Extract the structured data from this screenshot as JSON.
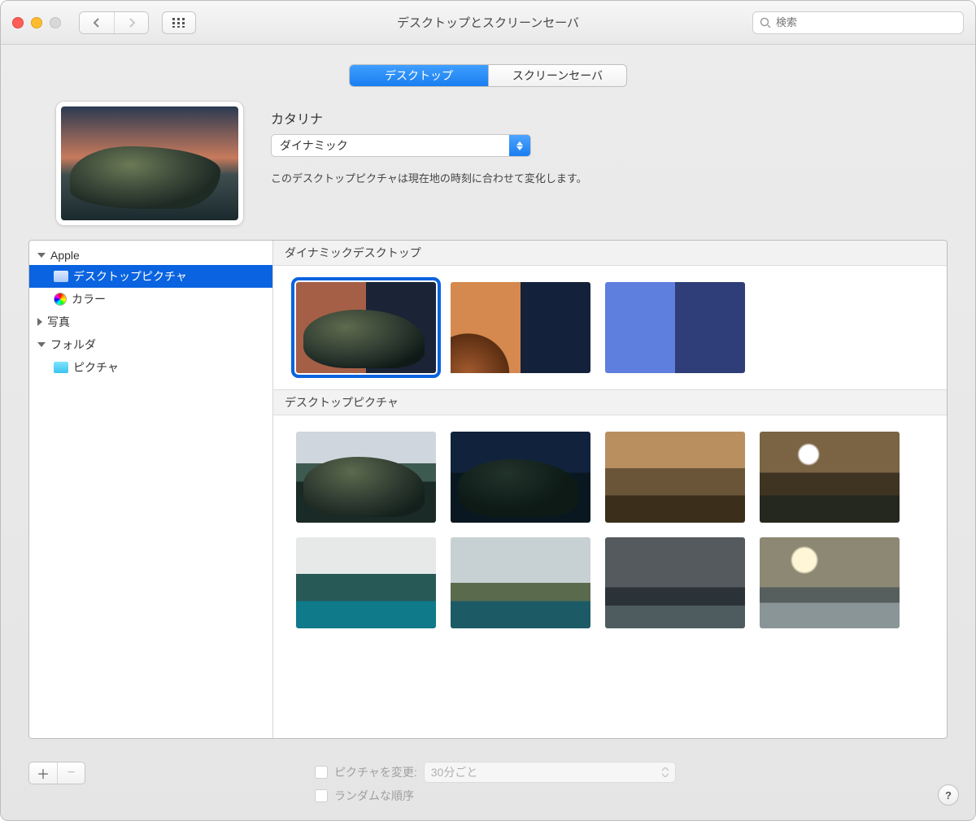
{
  "window": {
    "title": "デスクトップとスクリーンセーバ"
  },
  "search": {
    "placeholder": "検索"
  },
  "tabs": {
    "desktop": "デスクトップ",
    "screensaver": "スクリーンセーバ"
  },
  "selection": {
    "name": "カタリナ",
    "mode": "ダイナミック",
    "description": "このデスクトップピクチャは現在地の時刻に合わせて変化します。"
  },
  "sidebar": {
    "apple": "Apple",
    "desktop_pictures": "デスクトップピクチャ",
    "colors": "カラー",
    "photos": "写真",
    "folders": "フォルダ",
    "pictures_folder": "ピクチャ"
  },
  "sections": {
    "dynamic": "ダイナミックデスクトップ",
    "pictures": "デスクトップピクチャ"
  },
  "footer": {
    "change_picture": "ピクチャを変更:",
    "interval": "30分ごと",
    "random": "ランダムな順序"
  },
  "help": "?"
}
